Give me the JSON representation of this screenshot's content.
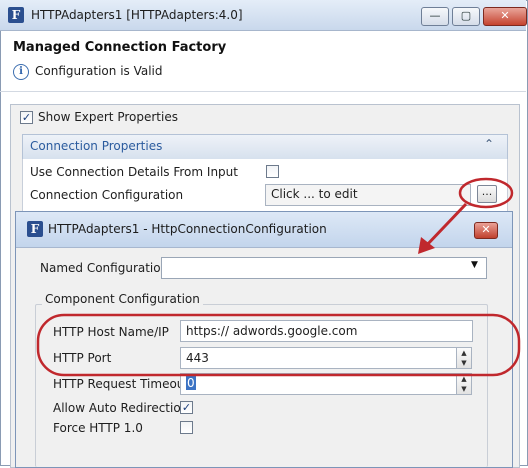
{
  "window": {
    "title": "HTTPAdapters1 [HTTPAdapters:4.0]",
    "icon": "F",
    "minimize": "—",
    "maximize": "▢",
    "close": "✕"
  },
  "header": {
    "title": "Managed Connection Factory",
    "status": "Configuration is Valid"
  },
  "expert": {
    "label": "Show Expert Properties",
    "checked": true
  },
  "connection_properties": {
    "section_label": "Connection Properties",
    "use_details_label": "Use Connection Details From Input",
    "config_label": "Connection Configuration",
    "config_value": "Click ... to edit",
    "ellipsis": "..."
  },
  "dialog": {
    "icon": "F",
    "title": "HTTPAdapters1 - HttpConnectionConfiguration",
    "close": "✕",
    "named_config_label": "Named Configuration",
    "named_config_value": "",
    "component_group": "Component Configuration",
    "host_label": "HTTP Host Name/IP",
    "host_value": "https:// adwords.google.com",
    "port_label": "HTTP Port",
    "port_value": "443",
    "timeout_label": "HTTP Request Timeout",
    "timeout_value": "0",
    "auto_redirect_label": "Allow Auto Redirection",
    "auto_redirect_checked": true,
    "force_http10_label": "Force HTTP 1.0",
    "force_http10_checked": false
  },
  "colors": {
    "annotation_red": "#c0282d",
    "titlebar": "#c9d8ec",
    "section_text": "#2b5b9e"
  },
  "icons": [
    "app-f-icon",
    "info-icon",
    "checkbox-checked-icon",
    "collapse-chevrons-icon",
    "dropdown-arrow-icon",
    "spinner-up-icon",
    "spinner-down-icon",
    "annotation-arrow-icon"
  ]
}
